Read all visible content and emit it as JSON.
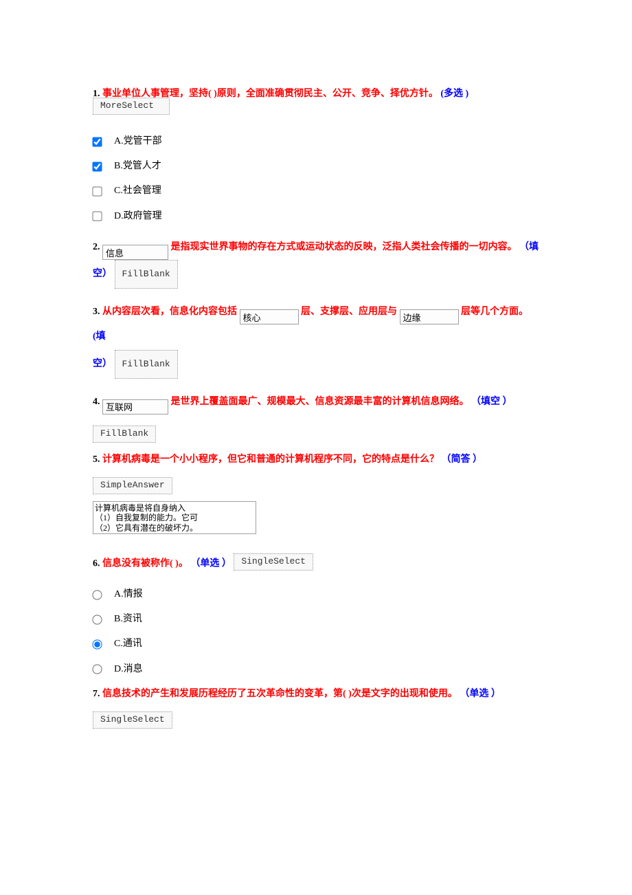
{
  "q1": {
    "num": "1.",
    "text": "事业单位人事管理，坚持( )原则，全面准确贯彻民主、公开、竞争、择优方针。",
    "type": "(多选 )",
    "type_value": "MoreSelect",
    "options": {
      "a": "A.党管干部",
      "b": "B.党管人才",
      "c": "C.社会管理",
      "d": "D.政府管理"
    }
  },
  "q2": {
    "num": "2.",
    "input1": "信息",
    "text_after": "是指现实世界事物的存在方式或运动状态的反映，泛指人类社会传播的一切内容。",
    "type_prefix": "（填",
    "type_suffix": "空）",
    "type_value": "FillBlank"
  },
  "q3": {
    "num": "3.",
    "text1": "从内容层次看，信息化内容包括",
    "input1": "核心",
    "text2": "层、支撑层、应用层与",
    "input2": "边缘",
    "text3": "层等几个方面。",
    "type_prefix": "(填",
    "type_suffix": "空）",
    "type_value": "FillBlank"
  },
  "q4": {
    "num": "4.",
    "input1": "互联网",
    "text_after": "是世界上覆盖面最广、规模最大、信息资源最丰富的计算机信息网络。",
    "type": "（填空 ）",
    "type_value": "FillBlank"
  },
  "q5": {
    "num": "5.",
    "text": "计算机病毒是一个小小程序，但它和普通的计算机程序不同，它的特点是什么？",
    "type": "（简答 ）",
    "type_value": "SimpleAnswer",
    "answer": "计算机病毒是将自身纳入\n（1）自我复制的能力。它可\n（2）它具有潜在的破坏力。"
  },
  "q6": {
    "num": "6.",
    "text": "信息没有被称作( )。",
    "type": "（单选 ）",
    "type_value": "SingleSelect",
    "options": {
      "a": "A.情报",
      "b": "B.资讯",
      "c": "C.通讯",
      "d": "D.消息"
    }
  },
  "q7": {
    "num": "7.",
    "text": "信息技术的产生和发展历程经历了五次革命性的变革，第( )次是文字的出现和使用。",
    "type": "（单选 ）",
    "type_value": "SingleSelect"
  }
}
